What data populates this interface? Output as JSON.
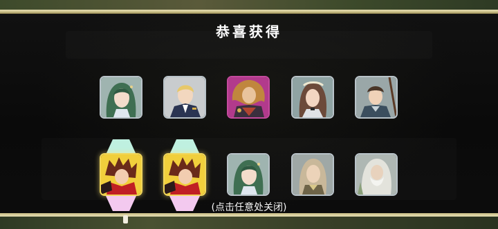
{
  "title": "恭喜获得",
  "hint": "(点击任意处关闭)",
  "rewards_row1": [
    {
      "character": "green-hair-maiden",
      "frame": "silver"
    },
    {
      "character": "blonde-officer",
      "frame": "silver"
    },
    {
      "character": "lion-maned-warrior",
      "frame": "magenta"
    },
    {
      "character": "brown-hair-lady",
      "frame": "silver"
    },
    {
      "character": "spear-youth",
      "frame": "silver"
    }
  ],
  "rewards_row2": [
    {
      "character": "red-scarf-hero",
      "frame": "gold",
      "highlighted": true
    },
    {
      "character": "red-scarf-hero",
      "frame": "gold",
      "highlighted": true
    },
    {
      "character": "green-hair-maiden",
      "frame": "silver"
    },
    {
      "character": "long-hair-elder",
      "frame": "silver"
    },
    {
      "character": "white-beard-sage",
      "frame": "silver"
    }
  ],
  "colors": {
    "frame_silver": "#b9c3c9",
    "frame_magenta": "#c34a9c",
    "frame_gold": "#f1d65a",
    "hex_top": "#bff0e0",
    "hex_bottom": "#f3c9ef",
    "border_line": "#e6dfb5"
  }
}
